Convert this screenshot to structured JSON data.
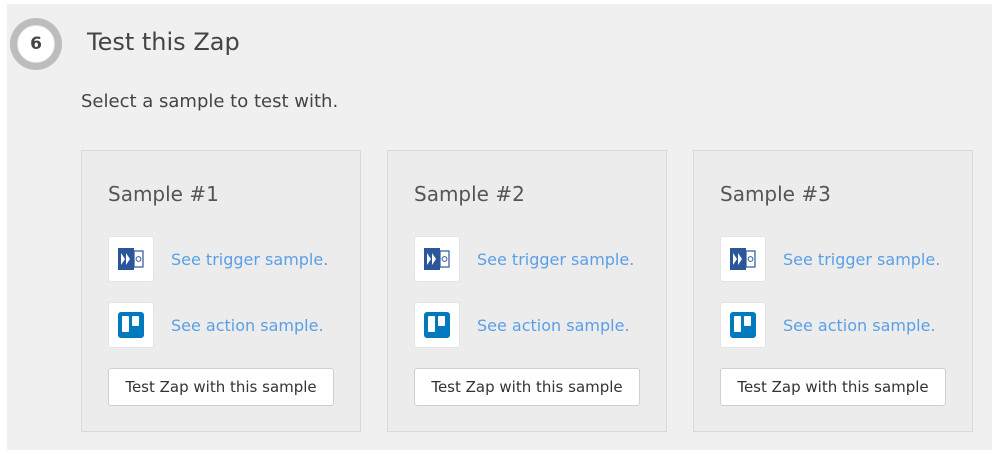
{
  "step": {
    "number": "6",
    "title": "Test this Zap"
  },
  "subtitle": "Select a sample to test with.",
  "samples": [
    {
      "title": "Sample #1",
      "trigger_link": "See trigger sample.",
      "action_link": "See action sample.",
      "button_label": "Test Zap with this sample"
    },
    {
      "title": "Sample #2",
      "trigger_link": "See trigger sample.",
      "action_link": "See action sample.",
      "button_label": "Test Zap with this sample"
    },
    {
      "title": "Sample #3",
      "trigger_link": "See trigger sample.",
      "action_link": "See action sample.",
      "button_label": "Test Zap with this sample"
    }
  ],
  "icons": {
    "trigger": "microsoft-dynamics-icon",
    "action": "trello-icon"
  },
  "colors": {
    "link": "#5a9fe6",
    "trigger_icon": "#2b579a",
    "action_icon": "#0079bf"
  }
}
